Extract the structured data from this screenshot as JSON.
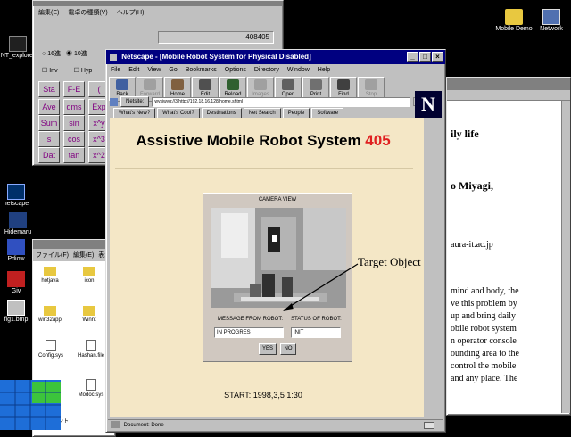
{
  "desktop": {
    "icons": [
      {
        "label": "NT_explorer",
        "icon": "calculator-icon"
      },
      {
        "label": "netscape",
        "icon": "netscape-icon"
      },
      {
        "label": "Hidemaru",
        "icon": "editor-icon"
      },
      {
        "label": "Pdiow",
        "icon": "app-icon"
      },
      {
        "label": "Giv",
        "icon": "viewer-icon"
      },
      {
        "label": "fig1.bmp",
        "icon": "image-icon"
      },
      {
        "label": "Mobile Demo",
        "icon": "folder-icon"
      },
      {
        "label": "Network",
        "icon": "network-icon"
      }
    ]
  },
  "calculator": {
    "menu": [
      "編集(E)",
      "電卓の種類(V)",
      "ヘルプ(H)"
    ],
    "display": "408405",
    "radio_hex": "16進",
    "radio_dec": "10進",
    "check_inv": "Inv",
    "check_hyp": "Hyp",
    "buttons": [
      "Sta",
      "F-E",
      "(",
      "Ave",
      "dms",
      "Exp",
      "Sum",
      "sin",
      "x^y",
      "s",
      "cos",
      "x^3",
      "Dat",
      "tan",
      "x^2"
    ]
  },
  "explorer": {
    "menu": [
      "ファイル(F)",
      "編集(E)",
      "表示"
    ],
    "items": [
      "hotjava",
      "icon",
      "win32app",
      "Winnt",
      "Config.sys",
      "Hashan.file",
      "Modoc.sys"
    ],
    "footer": "ドキュメント"
  },
  "document": {
    "lines": [
      "ily life",
      "o Miyagi,",
      "aura-it.ac.jp",
      "mind and body, the",
      "ve this problem by",
      "up and bring daily",
      "obile robot system",
      "n operator console",
      "ounding area to the",
      "control the mobile",
      "and any place. The"
    ]
  },
  "netscape": {
    "title": "Netscape - [Mobile Robot System for Physical Disabled]",
    "menu": [
      "File",
      "Edit",
      "View",
      "Go",
      "Bookmarks",
      "Options",
      "Directory",
      "Window",
      "Help"
    ],
    "toolbar": [
      "Back",
      "Forward",
      "Home",
      "Edit",
      "Reload",
      "Images",
      "Open",
      "Print",
      "Find",
      "Stop"
    ],
    "location_label": "Netsite:",
    "location_value": "wysiwyg://3/http://192.18.16.128/home.shtml",
    "directory_buttons": [
      "What's New?",
      "What's Cool?",
      "Destinations",
      "Net Search",
      "People",
      "Software"
    ],
    "status": "Document: Done"
  },
  "page": {
    "heading": "Assistive Mobile Robot System",
    "heading_number": "405",
    "camera_label": "CAMERA VIEW",
    "annotation": "Target Object",
    "message_label": "MESSAGE FROM ROBOT:",
    "status_label": "STATUS OF ROBOT:",
    "message_value": "IN PROGRES",
    "status_value": "INIT",
    "yes_label": "YES",
    "no_label": "NO",
    "start_text": "START: 1998,3,5 1:30"
  },
  "colors": {
    "heading_number": "#e02020",
    "titlebar_active": "#000080",
    "page_background": "#f4e7c6"
  }
}
